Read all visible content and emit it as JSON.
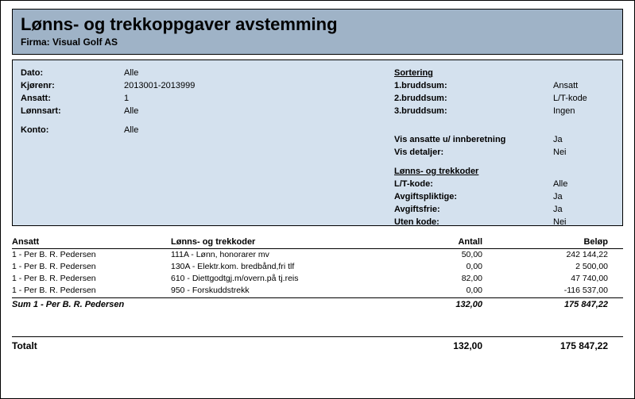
{
  "header": {
    "title": "Lønns- og trekkoppgaver avstemming",
    "firma_label": "Firma: Visual Golf AS"
  },
  "params_left": {
    "dato_label": "Dato:",
    "dato_val": "Alle",
    "kjorenr_label": "Kjørenr:",
    "kjorenr_val": "2013001-2013999",
    "ansatt_label": "Ansatt:",
    "ansatt_val": "1",
    "lonnsart_label": "Lønnsart:",
    "lonnsart_val": "Alle",
    "konto_label": "Konto:",
    "konto_val": "Alle"
  },
  "params_right": {
    "sortering_head": "Sortering",
    "b1_label": "1.bruddsum:",
    "b1_val": "Ansatt",
    "b2_label": "2.bruddsum:",
    "b2_val": "L/T-kode",
    "b3_label": "3.bruddsum:",
    "b3_val": "Ingen",
    "vis_ans_label": "Vis ansatte u/ innberetning",
    "vis_ans_val": "Ja",
    "vis_det_label": "Vis detaljer:",
    "vis_det_val": "Nei",
    "koder_head": "Lønns- og trekkoder",
    "lt_label": "L/T-kode:",
    "lt_val": "Alle",
    "avp_label": "Avgiftspliktige:",
    "avp_val": "Ja",
    "avf_label": "Avgiftsfrie:",
    "avf_val": "Ja",
    "uten_label": "Uten kode:",
    "uten_val": "Nei"
  },
  "table": {
    "headers": {
      "ansatt": "Ansatt",
      "koder": "Lønns- og trekkoder",
      "antall": "Antall",
      "belop": "Beløp"
    },
    "rows": [
      {
        "ansatt": "1 - Per B. R. Pedersen",
        "kode": "111A - Lønn, honorarer mv",
        "antall": "50,00",
        "belop": "242 144,22"
      },
      {
        "ansatt": "1 - Per B. R. Pedersen",
        "kode": "130A - Elektr.kom. bredbånd,fri tlf",
        "antall": "0,00",
        "belop": "2 500,00"
      },
      {
        "ansatt": "1 - Per B. R. Pedersen",
        "kode": "610 - Diettgodtgj.m/overn.på tj.reis",
        "antall": "82,00",
        "belop": "47 740,00"
      },
      {
        "ansatt": "1 - Per B. R. Pedersen",
        "kode": "950 - Forskuddstrekk",
        "antall": "0,00",
        "belop": "-116 537,00"
      }
    ],
    "sum": {
      "label": "Sum 1 - Per B. R. Pedersen",
      "antall": "132,00",
      "belop": "175  847,22"
    },
    "total": {
      "label": "Totalt",
      "antall": "132,00",
      "belop": "175  847,22"
    }
  }
}
